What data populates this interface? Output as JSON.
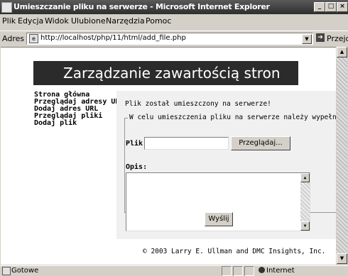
{
  "window": {
    "title": "Umieszczanie pliku na serwerze - Microsoft Internet Explorer",
    "minimize_glyph": "_",
    "maximize_glyph": "□",
    "close_glyph": "×"
  },
  "menu": {
    "items": [
      "Plik",
      "Edycja",
      "Widok",
      "Ulubione",
      "Narzędzia",
      "Pomoc"
    ]
  },
  "address_bar": {
    "label": "Adres",
    "url": "http://localhost/php/11/html/add_file.php",
    "go_label": "Przejdź"
  },
  "page": {
    "banner_title": "Zarządzanie zawartością stron",
    "nav": [
      "Strona główna",
      "Przeglądaj adresy URL",
      "Dodaj adres URL",
      "Przeglądaj pliki",
      "Dodaj plik"
    ],
    "message": "Plik został umieszczony na serwerze!",
    "legend": "W celu umieszczenia pliku na serwerze należy wypełnić formularz",
    "file_label": "Plik:",
    "file_value": "",
    "browse_label": "Przeglądaj...",
    "description_label": "Opis:",
    "description_value": "",
    "submit_label": "Wyślij",
    "footer": "© 2003 Larry E. Ullman and DMC Insights, Inc."
  },
  "status_bar": {
    "text": "Gotowe",
    "zone": "Internet"
  },
  "icons": {
    "page": "page-icon",
    "go": "go-arrow-icon",
    "globe": "globe-icon",
    "scroll_up": "scroll-up-icon",
    "scroll_down": "scroll-down-icon"
  }
}
